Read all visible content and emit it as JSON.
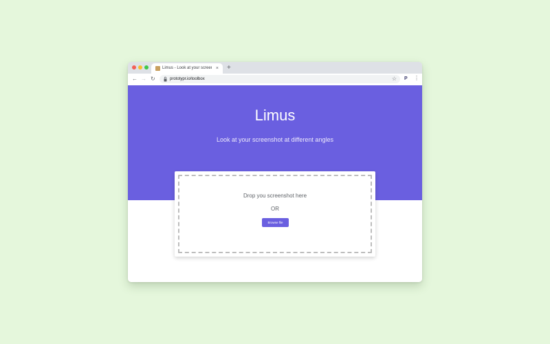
{
  "browser": {
    "tab_title": "Limus - Look at your screenshot",
    "tab_close": "×",
    "new_tab": "+",
    "url": "prototypr.io/toolbox",
    "nav": {
      "back": "←",
      "forward": "→",
      "reload": "↻"
    },
    "star": "☆",
    "extension": "P",
    "menu": "⋮"
  },
  "page": {
    "title": "Limus",
    "subtitle": "Look at your screenshot at different angles",
    "drop_text": "Drop you screenshot here",
    "or_text": "OR",
    "browse_label": "Browse file"
  },
  "colors": {
    "background": "#e5f7dc",
    "hero": "#6a5fe0",
    "accent": "#6a5fe0",
    "close": "#f25f58",
    "minimize": "#f9bd2e",
    "maximize": "#3fc84a"
  },
  "icons": [
    "close-window-icon",
    "minimize-window-icon",
    "maximize-window-icon",
    "favicon",
    "tab-close-icon",
    "new-tab-icon",
    "back-icon",
    "forward-icon",
    "reload-icon",
    "lock-icon",
    "star-icon",
    "extension-icon",
    "menu-icon"
  ]
}
